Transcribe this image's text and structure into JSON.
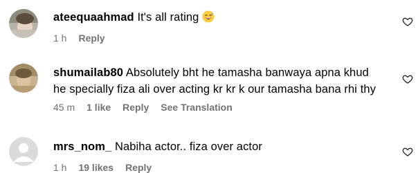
{
  "comments": [
    {
      "username": "ateequaahmad",
      "text": "It's all rating",
      "emoji": "grinning-sweat-emoji",
      "time": "1 h",
      "likes": "",
      "reply": "Reply",
      "translation": ""
    },
    {
      "username": "shumailab80",
      "text": "Absolutely bht he tamasha banwaya apna khud he specially fiza ali over acting kr kr k our tamasha bana rhi thy",
      "time": "45 m",
      "likes": "1 like",
      "reply": "Reply",
      "translation": "See Translation"
    },
    {
      "username": "mrs_nom_",
      "text": "Nabiha actor.. fiza over actor",
      "time": "1 h",
      "likes": "19 likes",
      "reply": "Reply",
      "translation": ""
    }
  ],
  "icons": {
    "like": "heart-outline-icon",
    "default_avatar": "default-avatar-icon"
  }
}
